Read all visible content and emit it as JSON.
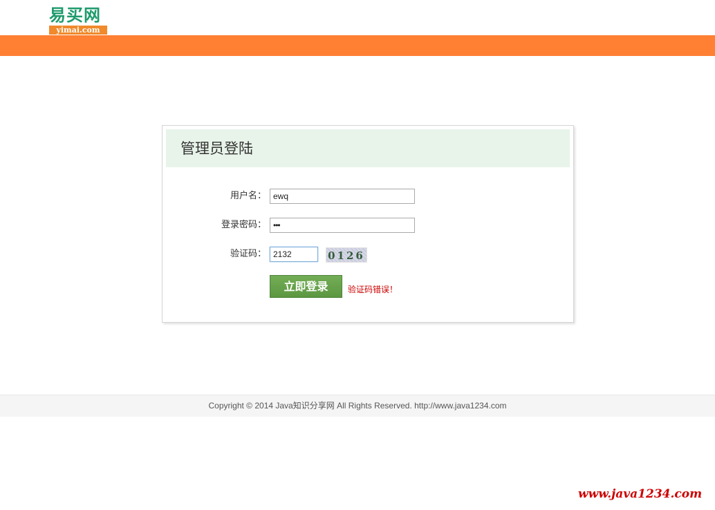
{
  "header": {
    "logo_cn": "易买网",
    "logo_en": "yimai.com"
  },
  "colors": {
    "accent_orange": "#ff7f33",
    "title_bar_green": "#e8f4ea",
    "button_green": "#5c9742",
    "error_red": "#cc0000"
  },
  "login": {
    "title": "管理员登陆",
    "username_label": "用户名：",
    "username_value": "ewq",
    "password_label": "登录密码：",
    "password_value": "•••",
    "captcha_label": "验证码：",
    "captcha_value": "2132",
    "captcha_image_text": "0126",
    "submit_label": "立即登录",
    "error_message": "验证码错误！"
  },
  "footer": {
    "copyright": "Copyright © 2014 Java知识分享网 All Rights Reserved. http://www.java1234.com"
  },
  "watermark": {
    "text": "www.java1234.com"
  }
}
